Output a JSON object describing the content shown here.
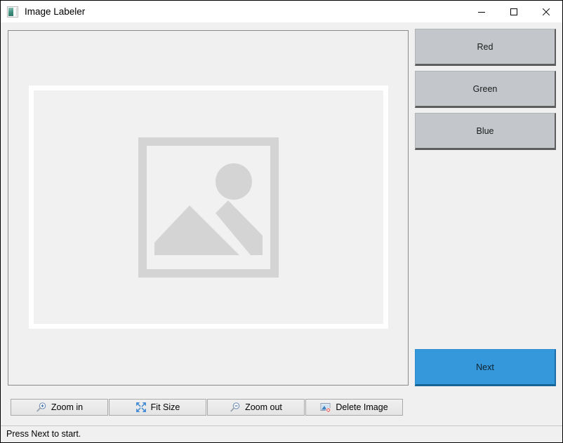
{
  "window": {
    "title": "Image Labeler",
    "icon": "image-app-icon",
    "controls": [
      {
        "name": "minimize",
        "glyph": "minimize-icon"
      },
      {
        "name": "maximize",
        "glyph": "maximize-icon"
      },
      {
        "name": "close",
        "glyph": "close-icon"
      }
    ]
  },
  "canvas": {
    "placeholder_icon": "image-placeholder-icon",
    "frame_background": "#ffffff",
    "inner_background": "#f1f1f1"
  },
  "labels": {
    "buttons": [
      {
        "label": "Red",
        "name": "label-button-red"
      },
      {
        "label": "Green",
        "name": "label-button-green"
      },
      {
        "label": "Blue",
        "name": "label-button-blue"
      }
    ],
    "button_color": "#c3c7cb"
  },
  "next": {
    "label": "Next",
    "color": "#3498db"
  },
  "toolbar": {
    "buttons": [
      {
        "label": "Zoom in",
        "icon": "magnifier-plus-icon",
        "name": "zoom-in-button"
      },
      {
        "label": "Fit Size",
        "icon": "fit-size-arrows-icon",
        "name": "fit-size-button"
      },
      {
        "label": "Zoom out",
        "icon": "magnifier-minus-icon",
        "name": "zoom-out-button"
      },
      {
        "label": "Delete Image",
        "icon": "delete-image-icon",
        "name": "delete-image-button"
      }
    ]
  },
  "status": {
    "text": "Press Next to start."
  }
}
